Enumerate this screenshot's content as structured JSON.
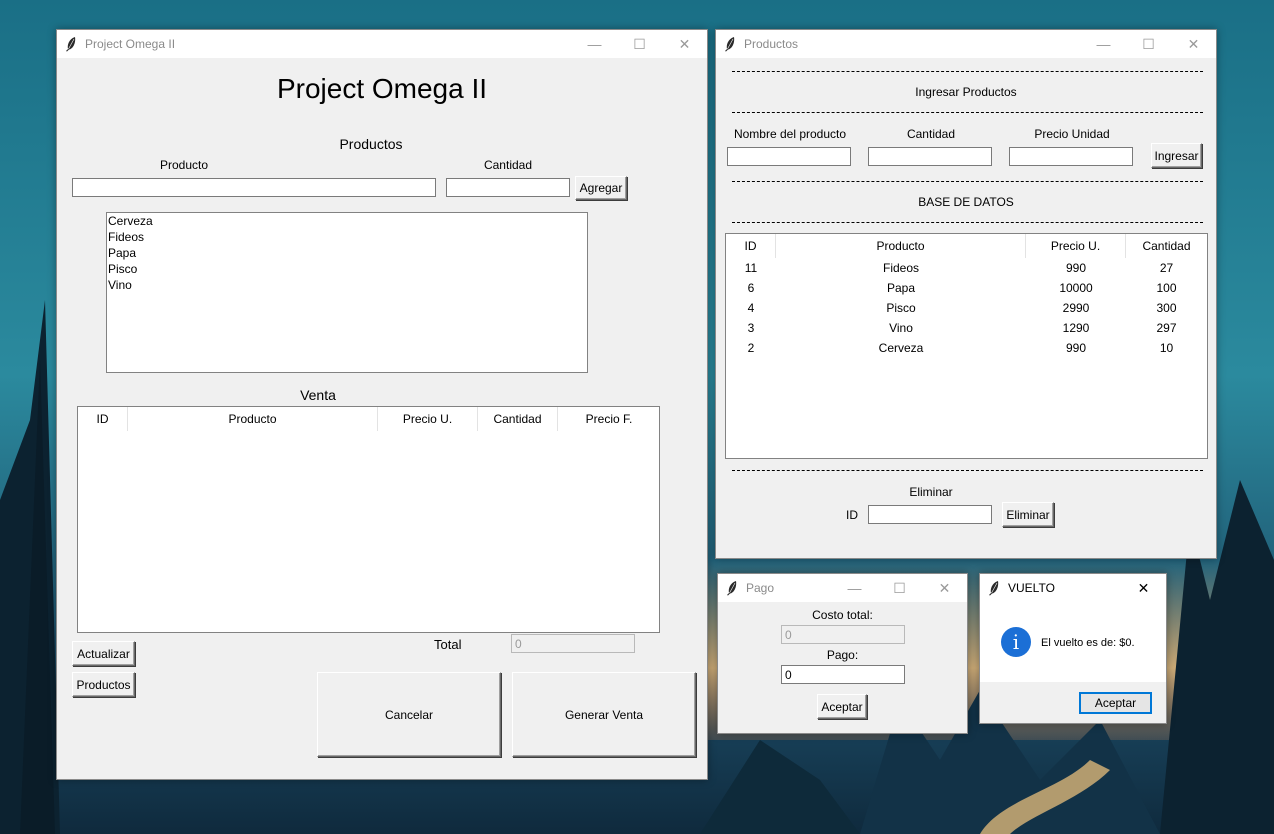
{
  "main_window": {
    "title": "Project Omega II",
    "heading": "Project Omega II",
    "productos_section": "Productos",
    "producto_label": "Producto",
    "cantidad_label": "Cantidad",
    "producto_value": "",
    "cantidad_value": "",
    "agregar_button": "Agregar",
    "product_list": [
      "Cerveza",
      "Fideos",
      "Papa",
      "Pisco",
      "Vino"
    ],
    "venta_label": "Venta",
    "venta_columns": [
      "ID",
      "Producto",
      "Precio U.",
      "Cantidad",
      "Precio F."
    ],
    "total_label": "Total",
    "total_value": "0",
    "actualizar_button": "Actualizar",
    "productos_button": "Productos",
    "cancelar_button": "Cancelar",
    "generar_button": "Generar Venta"
  },
  "productos_window": {
    "title": "Productos",
    "ingresar_heading": "Ingresar Productos",
    "nombre_label": "Nombre del producto",
    "cantidad_label": "Cantidad",
    "precio_label": "Precio Unidad",
    "nombre_value": "",
    "cantidad_value": "",
    "precio_value": "",
    "ingresar_button": "Ingresar",
    "db_heading": "BASE DE DATOS",
    "columns": [
      "ID",
      "Producto",
      "Precio U.",
      "Cantidad"
    ],
    "rows": [
      [
        "11",
        "Fideos",
        "990",
        "27"
      ],
      [
        "6",
        "Papa",
        "10000",
        "100"
      ],
      [
        "4",
        "Pisco",
        "2990",
        "300"
      ],
      [
        "3",
        "Vino",
        "1290",
        "297"
      ],
      [
        "2",
        "Cerveza",
        "990",
        "10"
      ]
    ],
    "eliminar_heading": "Eliminar",
    "id_label": "ID",
    "id_value": "",
    "eliminar_button": "Eliminar"
  },
  "pago_window": {
    "title": "Pago",
    "costo_label": "Costo total:",
    "costo_value": "0",
    "pago_label": "Pago:",
    "pago_value": "0",
    "aceptar_button": "Aceptar"
  },
  "vuelto_window": {
    "title": "VUELTO",
    "message": "El vuelto es de: $0.",
    "aceptar_button": "Aceptar"
  },
  "icons": {
    "title_icon": "feather-icon",
    "info_icon": "info-icon"
  },
  "colors": {
    "dialog_accent": "#0078d7",
    "info_icon": "#1b6fd6"
  }
}
